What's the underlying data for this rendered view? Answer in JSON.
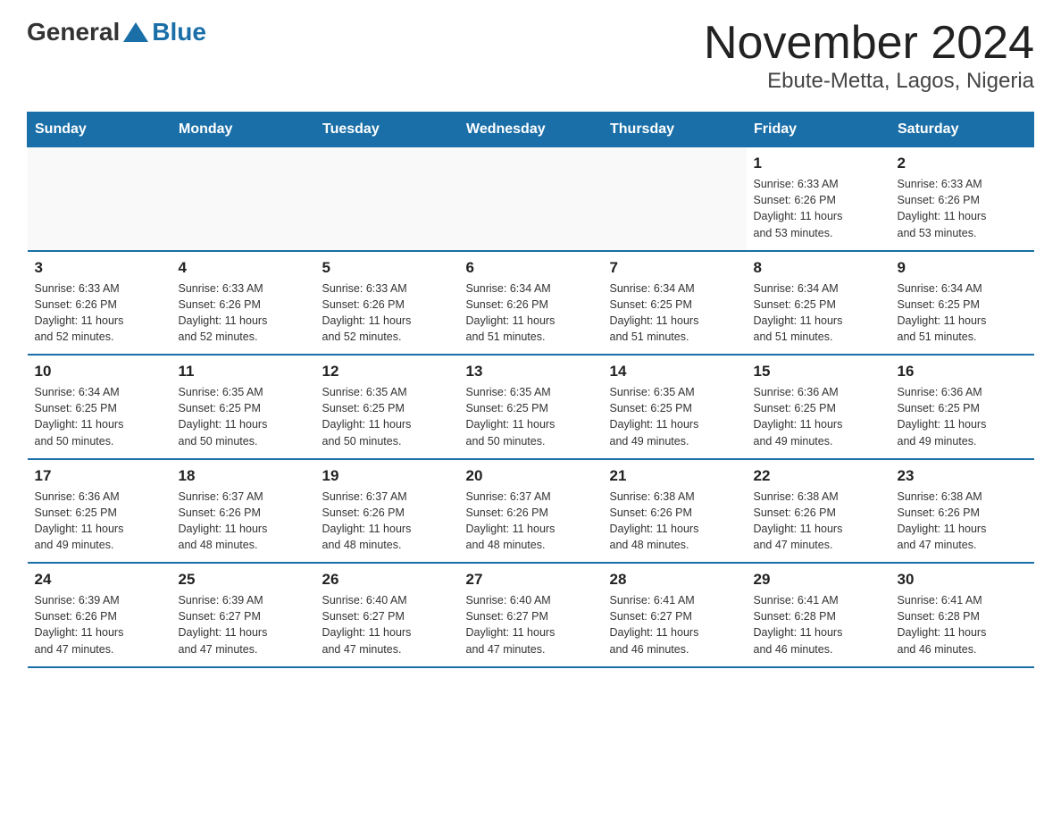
{
  "logo": {
    "general": "General",
    "blue": "Blue",
    "triangle_color": "#1a6fa8"
  },
  "header": {
    "month_year": "November 2024",
    "location": "Ebute-Metta, Lagos, Nigeria"
  },
  "days_of_week": [
    "Sunday",
    "Monday",
    "Tuesday",
    "Wednesday",
    "Thursday",
    "Friday",
    "Saturday"
  ],
  "weeks": [
    {
      "cells": [
        {
          "day": "",
          "info": ""
        },
        {
          "day": "",
          "info": ""
        },
        {
          "day": "",
          "info": ""
        },
        {
          "day": "",
          "info": ""
        },
        {
          "day": "",
          "info": ""
        },
        {
          "day": "1",
          "info": "Sunrise: 6:33 AM\nSunset: 6:26 PM\nDaylight: 11 hours\nand 53 minutes."
        },
        {
          "day": "2",
          "info": "Sunrise: 6:33 AM\nSunset: 6:26 PM\nDaylight: 11 hours\nand 53 minutes."
        }
      ]
    },
    {
      "cells": [
        {
          "day": "3",
          "info": "Sunrise: 6:33 AM\nSunset: 6:26 PM\nDaylight: 11 hours\nand 52 minutes."
        },
        {
          "day": "4",
          "info": "Sunrise: 6:33 AM\nSunset: 6:26 PM\nDaylight: 11 hours\nand 52 minutes."
        },
        {
          "day": "5",
          "info": "Sunrise: 6:33 AM\nSunset: 6:26 PM\nDaylight: 11 hours\nand 52 minutes."
        },
        {
          "day": "6",
          "info": "Sunrise: 6:34 AM\nSunset: 6:26 PM\nDaylight: 11 hours\nand 51 minutes."
        },
        {
          "day": "7",
          "info": "Sunrise: 6:34 AM\nSunset: 6:25 PM\nDaylight: 11 hours\nand 51 minutes."
        },
        {
          "day": "8",
          "info": "Sunrise: 6:34 AM\nSunset: 6:25 PM\nDaylight: 11 hours\nand 51 minutes."
        },
        {
          "day": "9",
          "info": "Sunrise: 6:34 AM\nSunset: 6:25 PM\nDaylight: 11 hours\nand 51 minutes."
        }
      ]
    },
    {
      "cells": [
        {
          "day": "10",
          "info": "Sunrise: 6:34 AM\nSunset: 6:25 PM\nDaylight: 11 hours\nand 50 minutes."
        },
        {
          "day": "11",
          "info": "Sunrise: 6:35 AM\nSunset: 6:25 PM\nDaylight: 11 hours\nand 50 minutes."
        },
        {
          "day": "12",
          "info": "Sunrise: 6:35 AM\nSunset: 6:25 PM\nDaylight: 11 hours\nand 50 minutes."
        },
        {
          "day": "13",
          "info": "Sunrise: 6:35 AM\nSunset: 6:25 PM\nDaylight: 11 hours\nand 50 minutes."
        },
        {
          "day": "14",
          "info": "Sunrise: 6:35 AM\nSunset: 6:25 PM\nDaylight: 11 hours\nand 49 minutes."
        },
        {
          "day": "15",
          "info": "Sunrise: 6:36 AM\nSunset: 6:25 PM\nDaylight: 11 hours\nand 49 minutes."
        },
        {
          "day": "16",
          "info": "Sunrise: 6:36 AM\nSunset: 6:25 PM\nDaylight: 11 hours\nand 49 minutes."
        }
      ]
    },
    {
      "cells": [
        {
          "day": "17",
          "info": "Sunrise: 6:36 AM\nSunset: 6:25 PM\nDaylight: 11 hours\nand 49 minutes."
        },
        {
          "day": "18",
          "info": "Sunrise: 6:37 AM\nSunset: 6:26 PM\nDaylight: 11 hours\nand 48 minutes."
        },
        {
          "day": "19",
          "info": "Sunrise: 6:37 AM\nSunset: 6:26 PM\nDaylight: 11 hours\nand 48 minutes."
        },
        {
          "day": "20",
          "info": "Sunrise: 6:37 AM\nSunset: 6:26 PM\nDaylight: 11 hours\nand 48 minutes."
        },
        {
          "day": "21",
          "info": "Sunrise: 6:38 AM\nSunset: 6:26 PM\nDaylight: 11 hours\nand 48 minutes."
        },
        {
          "day": "22",
          "info": "Sunrise: 6:38 AM\nSunset: 6:26 PM\nDaylight: 11 hours\nand 47 minutes."
        },
        {
          "day": "23",
          "info": "Sunrise: 6:38 AM\nSunset: 6:26 PM\nDaylight: 11 hours\nand 47 minutes."
        }
      ]
    },
    {
      "cells": [
        {
          "day": "24",
          "info": "Sunrise: 6:39 AM\nSunset: 6:26 PM\nDaylight: 11 hours\nand 47 minutes."
        },
        {
          "day": "25",
          "info": "Sunrise: 6:39 AM\nSunset: 6:27 PM\nDaylight: 11 hours\nand 47 minutes."
        },
        {
          "day": "26",
          "info": "Sunrise: 6:40 AM\nSunset: 6:27 PM\nDaylight: 11 hours\nand 47 minutes."
        },
        {
          "day": "27",
          "info": "Sunrise: 6:40 AM\nSunset: 6:27 PM\nDaylight: 11 hours\nand 47 minutes."
        },
        {
          "day": "28",
          "info": "Sunrise: 6:41 AM\nSunset: 6:27 PM\nDaylight: 11 hours\nand 46 minutes."
        },
        {
          "day": "29",
          "info": "Sunrise: 6:41 AM\nSunset: 6:28 PM\nDaylight: 11 hours\nand 46 minutes."
        },
        {
          "day": "30",
          "info": "Sunrise: 6:41 AM\nSunset: 6:28 PM\nDaylight: 11 hours\nand 46 minutes."
        }
      ]
    }
  ]
}
